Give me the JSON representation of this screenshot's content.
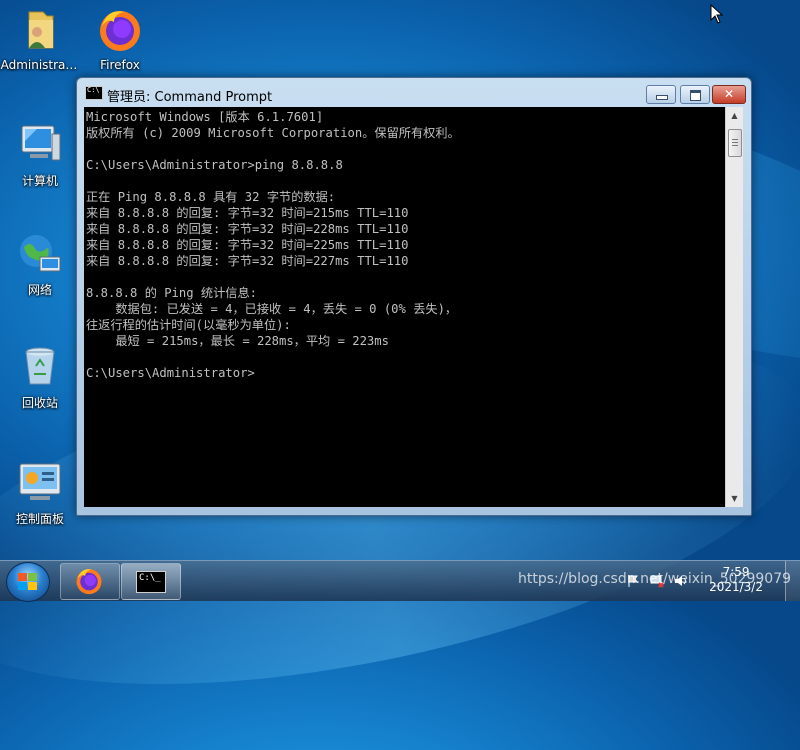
{
  "desktop": {
    "icons": [
      {
        "label": "Administra…"
      },
      {
        "label": "Firefox"
      },
      {
        "label": "计算机"
      },
      {
        "label": "网络"
      },
      {
        "label": "回收站"
      },
      {
        "label": "控制面板"
      }
    ]
  },
  "window": {
    "title": "管理员: Command Prompt",
    "buttons": {
      "close": "✕"
    }
  },
  "console": {
    "lines": [
      "Microsoft Windows [版本 6.1.7601]",
      "版权所有 (c) 2009 Microsoft Corporation。保留所有权利。",
      "",
      "C:\\Users\\Administrator>ping 8.8.8.8",
      "",
      "正在 Ping 8.8.8.8 具有 32 字节的数据:",
      "来自 8.8.8.8 的回复: 字节=32 时间=215ms TTL=110",
      "来自 8.8.8.8 的回复: 字节=32 时间=228ms TTL=110",
      "来自 8.8.8.8 的回复: 字节=32 时间=225ms TTL=110",
      "来自 8.8.8.8 的回复: 字节=32 时间=227ms TTL=110",
      "",
      "8.8.8.8 的 Ping 统计信息:",
      "    数据包: 已发送 = 4，已接收 = 4，丢失 = 0 (0% 丢失)，",
      "往返行程的估计时间(以毫秒为单位):",
      "    最短 = 215ms，最长 = 228ms，平均 = 223ms",
      "",
      "C:\\Users\\Administrator>"
    ]
  },
  "taskbar": {
    "cmd_icon_text": "C:\\_",
    "clock": {
      "time": "7:59",
      "date": "2021/3/2"
    }
  },
  "watermark": "https://blog.csdn.net/weixin_50299079",
  "colors": {
    "console_bg": "#000000",
    "console_fg": "#c0c0c0"
  }
}
